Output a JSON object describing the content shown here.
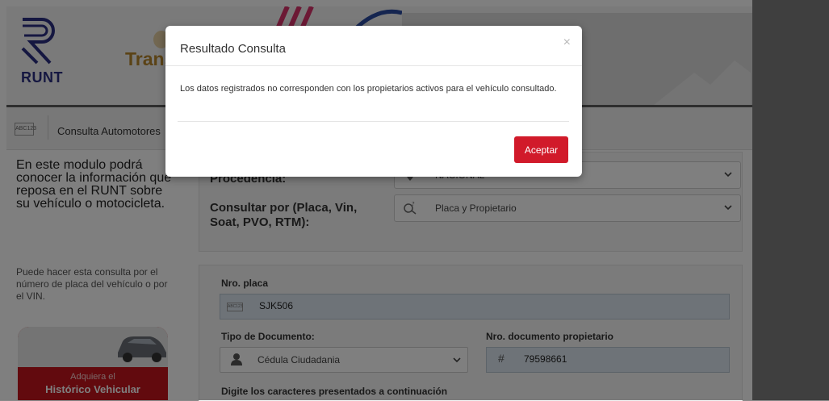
{
  "header": {
    "logo_text": "RUNT",
    "partner_text": "Trans"
  },
  "subbar": {
    "badge": "ABC123",
    "title": "Consulta Automotores"
  },
  "left": {
    "title": "En este modulo podrá conocer la información que reposa en el RUNT sobre su vehículo o motocicleta.",
    "description": "Puede hacer esta consulta por el número de placa del vehículo o por el VIN.",
    "promo_line1": "Adquiera el",
    "promo_line2": "Histórico Vehicular"
  },
  "form": {
    "procedencia_label": "Procedencia:",
    "procedencia_value": "NACIONAL",
    "consultar_label": "Consultar por (Placa, Vin, Soat, PVO, RTM):",
    "consultar_value": "Placa y Propietario",
    "placa_label": "Nro. placa",
    "placa_badge": "ABC123",
    "placa_value": "SJK506",
    "tipo_doc_label": "Tipo de Documento:",
    "tipo_doc_value": "Cédula Ciudadania",
    "nro_doc_label": "Nro. documento propietario",
    "nro_doc_symbol": "#",
    "nro_doc_value": "79598661",
    "captcha_label": "Digite los caracteres presentados a continuación"
  },
  "modal": {
    "title": "Resultado Consulta",
    "close_symbol": "×",
    "message": "Los datos registrados no corresponden con los propietarios activos para el vehículo consultado.",
    "accept_label": "Aceptar"
  },
  "colors": {
    "accent_red": "#d11a2a",
    "runt_blue": "#2a2f82"
  }
}
